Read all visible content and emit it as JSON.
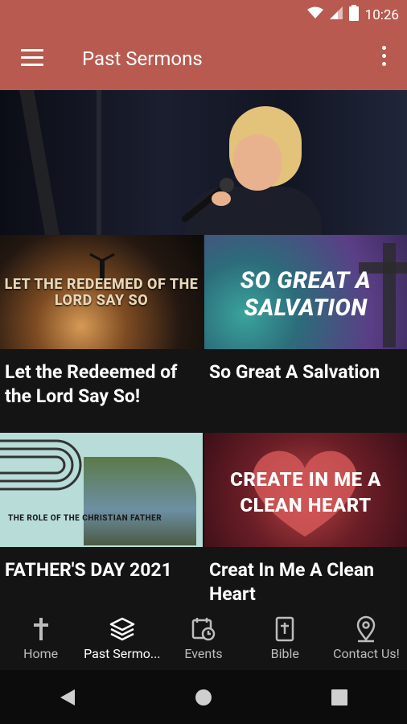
{
  "status": {
    "time": "10:26"
  },
  "appbar": {
    "title": "Past Sermons"
  },
  "sermons": [
    {
      "title": "Let the Redeemed of the Lord Say So!",
      "thumb_text": "LET THE REDEEMED OF THE LORD SAY SO"
    },
    {
      "title": "So Great A Salvation",
      "thumb_text": "SO GREAT A SALVATION"
    },
    {
      "title": "FATHER'S DAY 2021",
      "thumb_text": "THE ROLE OF THE CHRISTIAN FATHER"
    },
    {
      "title": "Creat In Me A Clean Heart",
      "thumb_text": "CREATE IN ME A CLEAN HEART"
    }
  ],
  "nav": [
    {
      "label": "Home",
      "icon": "cross-icon"
    },
    {
      "label": "Past Sermo...",
      "icon": "layers-icon"
    },
    {
      "label": "Events",
      "icon": "calendar-clock-icon"
    },
    {
      "label": "Bible",
      "icon": "bible-icon"
    },
    {
      "label": "Contact Us!",
      "icon": "location-pin-icon"
    }
  ],
  "colors": {
    "appbar": "#b85a4f",
    "background": "#141414"
  }
}
